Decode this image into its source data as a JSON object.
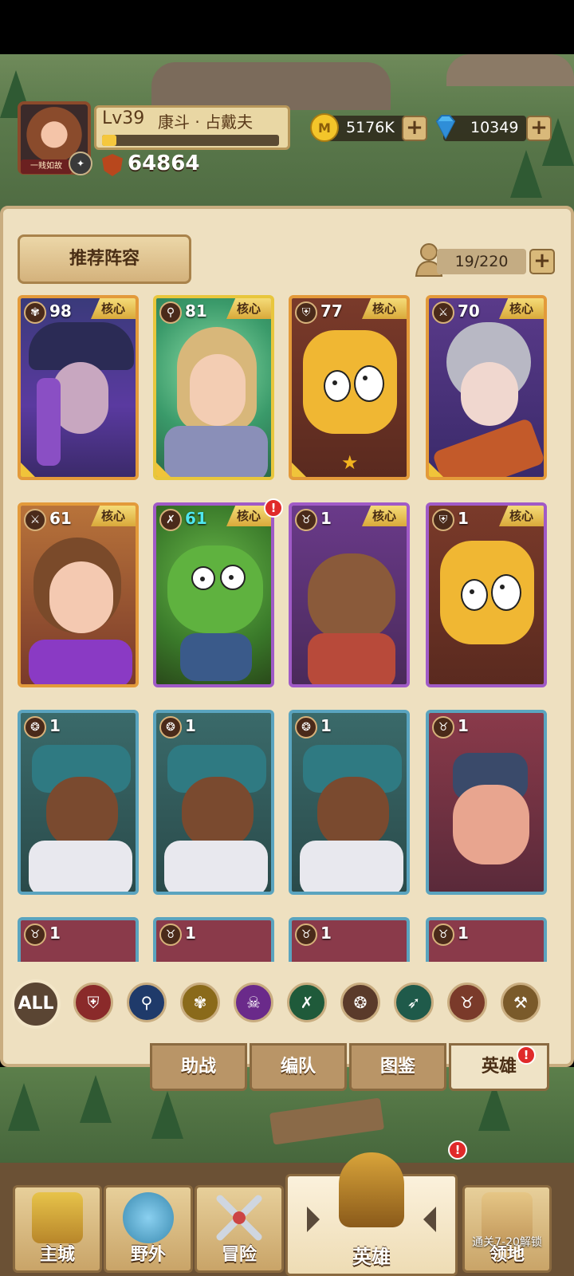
{
  "player": {
    "level": "Lv39",
    "name": "康斗 · 占戴夫",
    "avatar_tag": "一贱如故",
    "power": "64864",
    "exp_fraction": 0.08
  },
  "resources": {
    "gold": "5176K",
    "diamonds": "10349"
  },
  "panel": {
    "recommend_label": "推荐阵容",
    "hero_count": "19/220"
  },
  "cards": [
    {
      "level": "98",
      "core": "核心",
      "type_icon": "support-icon"
    },
    {
      "level": "81",
      "core": "核心",
      "type_icon": "mage-staff-icon"
    },
    {
      "level": "77",
      "core": "核心",
      "type_icon": "shield-icon"
    },
    {
      "level": "70",
      "core": "核心",
      "type_icon": "axe-icon"
    },
    {
      "level": "61",
      "core": "核心",
      "type_icon": "axe-icon"
    },
    {
      "level": "61",
      "core": "核心",
      "type_icon": "daggers-icon"
    },
    {
      "level": "1",
      "core": "核心",
      "type_icon": "beast-icon"
    },
    {
      "level": "1",
      "core": "核心",
      "type_icon": "shield-icon"
    },
    {
      "level": "1",
      "type_icon": "paw-icon"
    },
    {
      "level": "1",
      "type_icon": "paw-icon"
    },
    {
      "level": "1",
      "type_icon": "paw-icon"
    },
    {
      "level": "1",
      "type_icon": "beast-icon"
    },
    {
      "level": "1",
      "type_icon": "beast-icon"
    },
    {
      "level": "1",
      "type_icon": "beast-icon"
    },
    {
      "level": "1",
      "type_icon": "beast-icon"
    },
    {
      "level": "1",
      "type_icon": "beast-icon"
    }
  ],
  "filters": {
    "all_label": "ALL",
    "icons": [
      "shield-icon",
      "mage-staff-icon",
      "support-icon",
      "skull-icon",
      "daggers-icon",
      "paw-icon",
      "bow-icon",
      "beast-icon",
      "axe-icon"
    ]
  },
  "sub_tabs": [
    "助战",
    "编队",
    "图鉴",
    "英雄"
  ],
  "bottom_nav": {
    "main_city": "主城",
    "wild": "野外",
    "adventure": "冒险",
    "heroes": "英雄",
    "territory": "领地",
    "territory_locked_hint": "通关7-20解锁"
  },
  "badge_mark": "!"
}
